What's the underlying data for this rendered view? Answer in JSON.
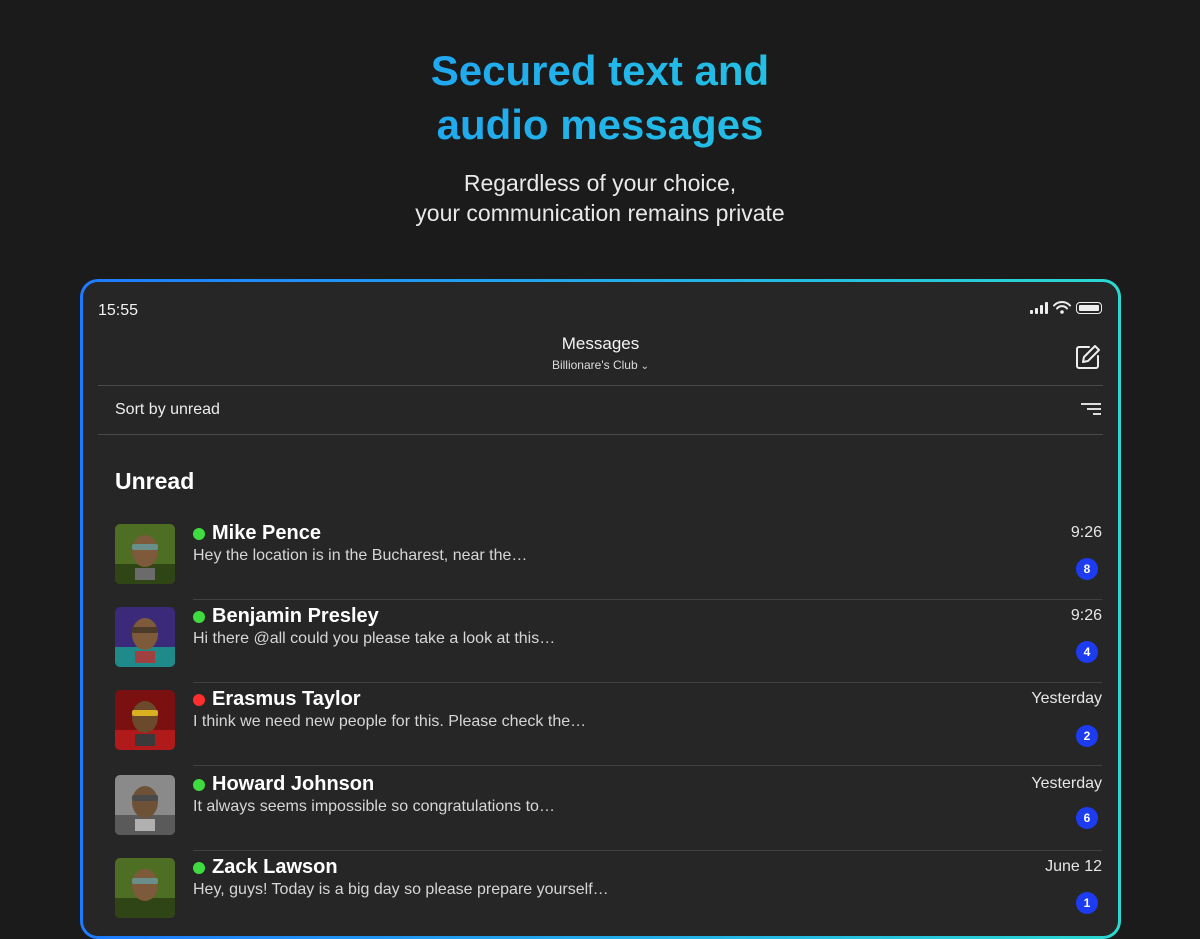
{
  "hero": {
    "title_line1": "Secured text and",
    "title_line2": "audio messages",
    "subtitle_line1": "Regardless of your choice,",
    "subtitle_line2": "your communication remains private"
  },
  "status_bar": {
    "time": "15:55"
  },
  "nav": {
    "title": "Messages",
    "subtitle": "Billionare's Club"
  },
  "sort": {
    "label": "Sort by unread"
  },
  "section": {
    "title": "Unread"
  },
  "colors": {
    "online": "#3fdc3f",
    "busy": "#ff2d2d",
    "badge": "#1d3cf2"
  },
  "conversations": [
    {
      "name": "Mike Pence",
      "status": "online",
      "preview": "Hey the location is in the Bucharest, near the…",
      "time": "9:26",
      "unread": "8"
    },
    {
      "name": "Benjamin Presley",
      "status": "online",
      "preview": "Hi there @all could you please take a look at this…",
      "time": "9:26",
      "unread": "4"
    },
    {
      "name": "Erasmus Taylor",
      "status": "busy",
      "preview": "I think we need new people for this. Please check the…",
      "time": "Yesterday",
      "unread": "2"
    },
    {
      "name": "Howard Johnson",
      "status": "online",
      "preview": "It always seems impossible so congratulations to…",
      "time": "Yesterday",
      "unread": "6"
    },
    {
      "name": "Zack Lawson",
      "status": "online",
      "preview": "Hey, guys! Today is a big day so please prepare yourself…",
      "time": "June 12",
      "unread": "1"
    }
  ]
}
